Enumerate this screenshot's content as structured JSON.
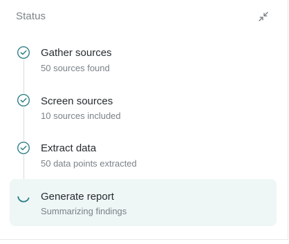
{
  "header": {
    "title": "Status",
    "collapse_icon": "collapse-arrows-icon"
  },
  "colors": {
    "accent": "#2f7f86",
    "completed_check": "#2f7f86",
    "active_background": "#eef6f6",
    "connector": "#d6dde0"
  },
  "steps": [
    {
      "label": "Gather sources",
      "detail": "50 sources found",
      "state": "completed",
      "icon": "check-circle-icon"
    },
    {
      "label": "Screen sources",
      "detail": "10 sources included",
      "state": "completed",
      "icon": "check-circle-icon"
    },
    {
      "label": "Extract data",
      "detail": "50 data points extracted",
      "state": "completed",
      "icon": "check-circle-icon"
    },
    {
      "label": "Generate report",
      "detail": "Summarizing findings",
      "state": "in-progress",
      "icon": "spinner-icon"
    }
  ]
}
